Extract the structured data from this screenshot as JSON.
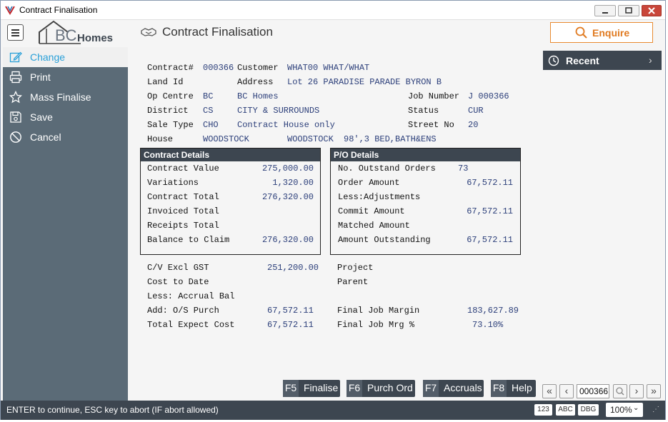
{
  "window": {
    "title": "Contract Finalisation"
  },
  "header": {
    "logo_text_bc": "BC",
    "logo_text_homes": "Homes",
    "page_title": "Contract Finalisation",
    "enquire_label": "Enquire"
  },
  "sidebar": {
    "items": [
      {
        "label": "Change",
        "icon": "pencil-icon",
        "active": true
      },
      {
        "label": "Print",
        "icon": "printer-icon",
        "active": false
      },
      {
        "label": "Mass Finalise",
        "icon": "star-icon",
        "active": false
      },
      {
        "label": "Save",
        "icon": "save-icon",
        "active": false
      },
      {
        "label": "Cancel",
        "icon": "cancel-icon",
        "active": false
      }
    ]
  },
  "recent": {
    "label": "Recent"
  },
  "contract": {
    "contract_label": "Contract#",
    "contract_no": "000366",
    "customer_label": "Customer",
    "customer": "WHAT00 WHAT/WHAT",
    "land_label": "Land Id",
    "address_label": "Address",
    "address": "Lot 26 PARADISE PARADE BYRON B",
    "opcentre_label": "Op Centre",
    "opcentre_code": "BC",
    "opcentre_name": "BC Homes",
    "jobnumber_label": "Job Number",
    "jobnumber": "J 000366",
    "district_label": "District",
    "district_code": "CS",
    "district_name": "CITY & SURROUNDS",
    "status_label": "Status",
    "status": "CUR",
    "saletype_label": "Sale Type",
    "saletype_code": "CHO",
    "saletype_name": "Contract House only",
    "streetno_label": "Street No",
    "streetno": "20",
    "house_label": "House",
    "house_code": "WOODSTOCK",
    "house_name": "WOODSTOCK",
    "house_desc": "98',3 BED,BATH&ENS"
  },
  "contract_details": {
    "title": "Contract Details",
    "rows": [
      {
        "label": "Contract Value",
        "value": "275,000.00"
      },
      {
        "label": "Variations",
        "value": "1,320.00"
      },
      {
        "label": "Contract Total",
        "value": "276,320.00"
      },
      {
        "label": "Invoiced Total",
        "value": ""
      },
      {
        "label": "Receipts Total",
        "value": ""
      },
      {
        "label": "Balance to Claim",
        "value": "276,320.00"
      }
    ]
  },
  "po_details": {
    "title": "P/O Details",
    "rows": [
      {
        "label": "No. Outstand Orders",
        "value": "73"
      },
      {
        "label": "Order Amount",
        "value": "67,572.11"
      },
      {
        "label": "Less:Adjustments",
        "value": ""
      },
      {
        "label": "Commit Amount",
        "value": "67,572.11"
      },
      {
        "label": "Matched Amount",
        "value": ""
      },
      {
        "label": "Amount Outstanding",
        "value": "67,572.11"
      }
    ]
  },
  "costs": {
    "rows": [
      {
        "label": "C/V Excl GST",
        "value": "251,200.00"
      },
      {
        "label": "Cost to Date",
        "value": ""
      },
      {
        "label": "Less: Accrual Bal",
        "value": ""
      },
      {
        "label": "Add:  O/S Purch",
        "value": "67,572.11"
      },
      {
        "label": "Total Expect Cost",
        "value": "67,572.11"
      }
    ]
  },
  "margins": {
    "project_label": "Project",
    "parent_label": "Parent",
    "final_margin_label": "Final Job Margin",
    "final_margin": "183,627.89",
    "final_margin_pct_label": "Final Job Mrg %",
    "final_margin_pct": "73.10%"
  },
  "fkeys": [
    {
      "key": "F5",
      "label": "Finalise"
    },
    {
      "key": "F6",
      "label": "Purch Ord"
    },
    {
      "key": "F7",
      "label": "Accruals"
    },
    {
      "key": "F8",
      "label": "Help"
    }
  ],
  "nav": {
    "record": "000366"
  },
  "statusbar": {
    "text": "ENTER to continue, ESC key to abort (IF abort allowed)",
    "mode_123": "123",
    "mode_abc": "ABC",
    "mode_dbg": "DBG",
    "zoom": "100%"
  },
  "colors": {
    "sidebar_bg": "#5b6b77",
    "dark_panel": "#3d4650",
    "accent_blue": "#2aa0d8",
    "enquire_orange": "#e07a20"
  }
}
